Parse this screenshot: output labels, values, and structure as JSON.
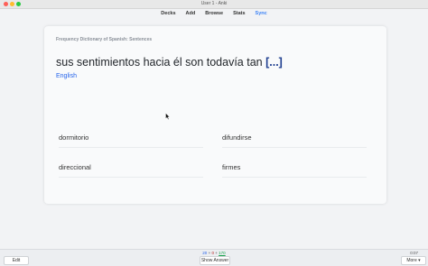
{
  "window": {
    "title": "User 1 - Anki"
  },
  "toolbar": {
    "items": [
      "Decks",
      "Add",
      "Browse",
      "Stats",
      "Sync"
    ]
  },
  "card": {
    "deck_title": "Frequency Dictionary of Spanish: Sentences",
    "sentence_prefix": "sus sentimientos hacia él son todavía tan",
    "cloze": "[...]",
    "english_link": "English",
    "choices": [
      "dormitorio",
      "difundirse",
      "direccional",
      "firmes"
    ]
  },
  "bottom": {
    "edit_label": "Edit",
    "show_answer_label": "Show Answer",
    "more_label": "More ▾",
    "counts": {
      "new": "20",
      "plus1": "+",
      "learn": "0",
      "plus2": "+",
      "review": "170"
    },
    "timer": "0:07"
  },
  "colors": {
    "accent": "#3b82f6",
    "cloze": "#1d3d8f",
    "link": "#2563eb",
    "new_count": "#2563eb",
    "learn_count": "#b91c1c",
    "review_count": "#16a34a"
  }
}
